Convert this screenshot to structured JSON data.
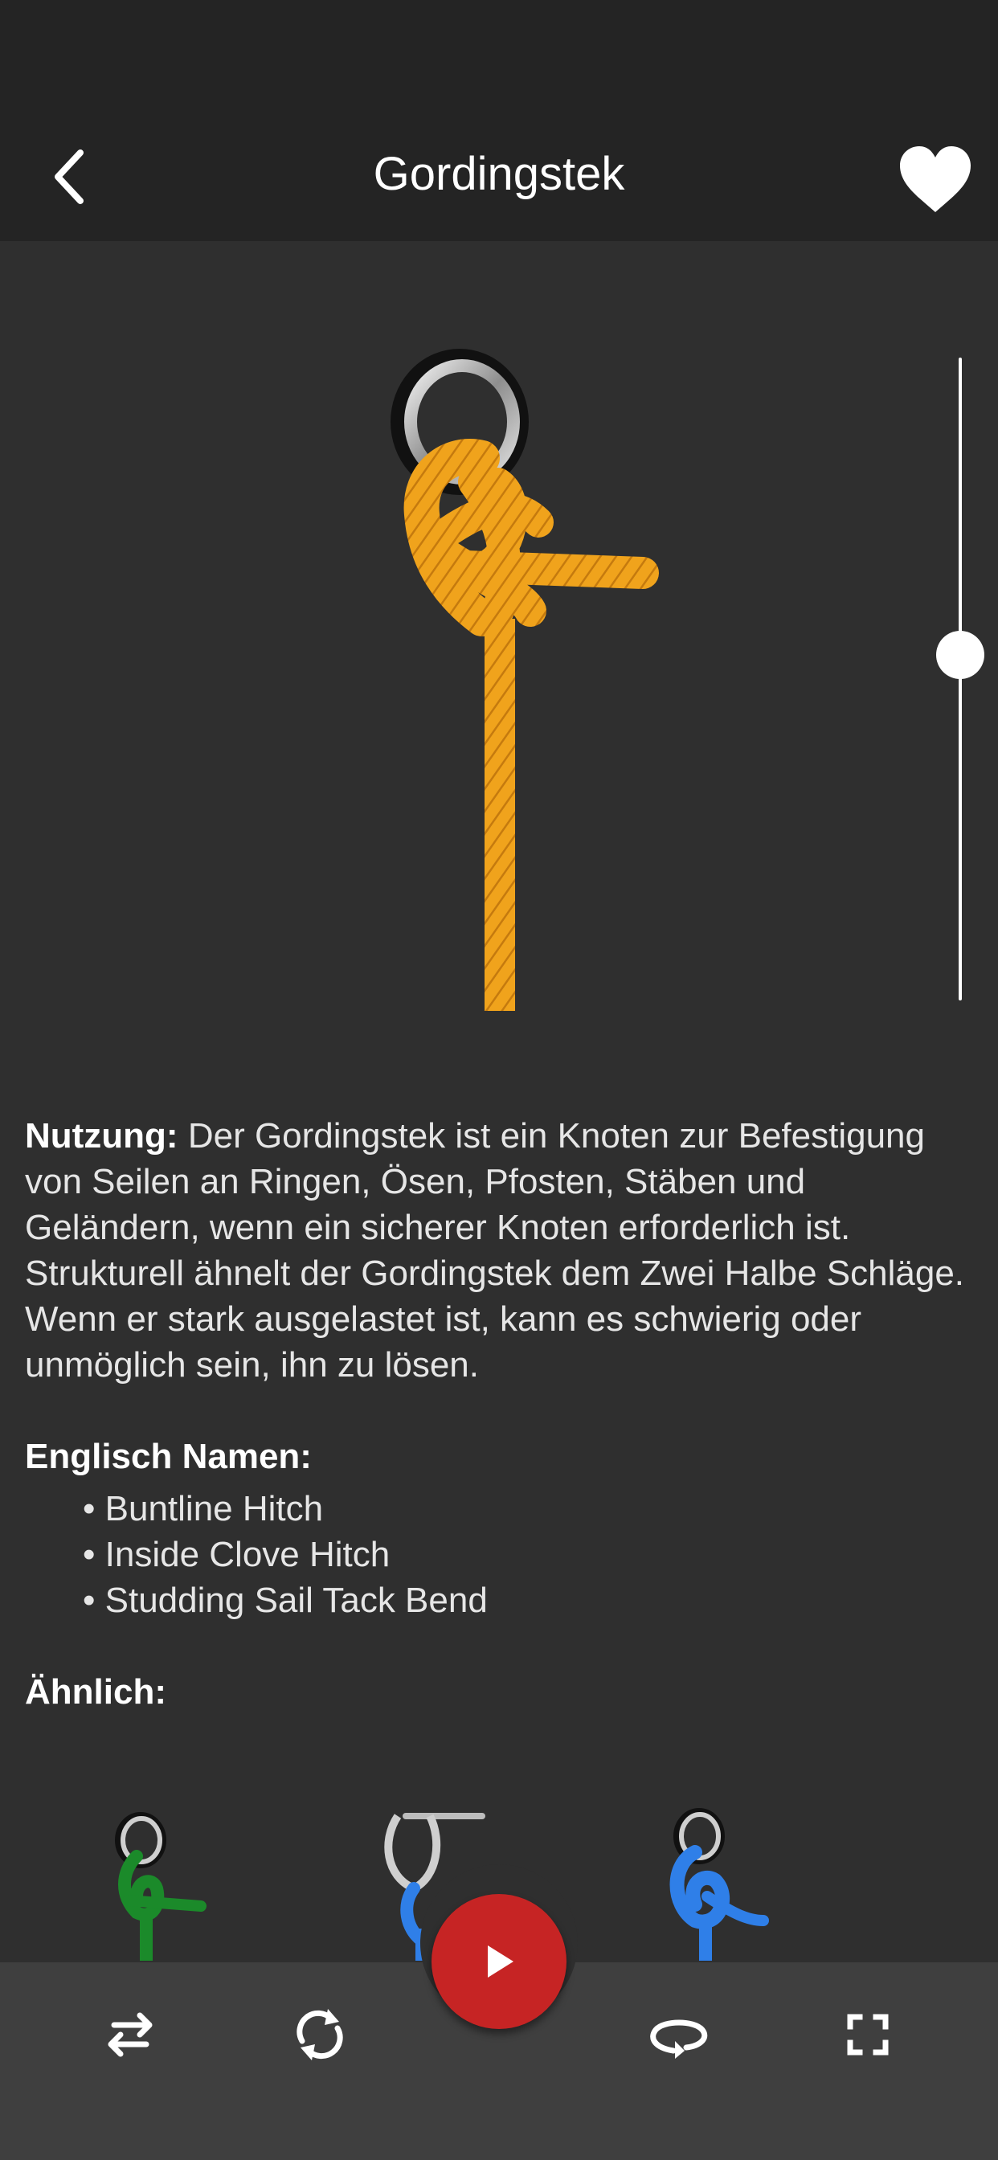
{
  "header": {
    "title": "Gordingstek",
    "back_icon": "chevron-left-icon",
    "favorite_icon": "heart-icon"
  },
  "knot_view": {
    "rope_color": "#f0a31c",
    "ring_color": "#c0c0c0",
    "progress": 0.46
  },
  "usage": {
    "label": "Nutzung:",
    "text": " Der Gordingstek ist ein Knoten zur Befestigung von Seilen an Ringen, Ösen, Pfosten, Stäben und Geländern, wenn ein sicherer Knoten erforderlich ist. Strukturell ähnelt der Gordingstek dem Zwei Halbe Schläge. Wenn er stark ausgelastet ist, kann es schwierig oder unmöglich sein, ihn zu lösen."
  },
  "english_names": {
    "label": "Englisch Namen:",
    "items": [
      "Buntline Hitch",
      "Inside Clove Hitch",
      "Studding Sail Tack Bend"
    ]
  },
  "similar": {
    "label": "Ähnlich:",
    "thumbs": [
      {
        "rope_color": "#1b8a2a"
      },
      {
        "rope_color": "#2f7fe8"
      },
      {
        "rope_color": "#2f7fe8"
      }
    ]
  },
  "toolbar": {
    "buttons": [
      "swap-icon",
      "rotate-icon",
      "play-icon",
      "loop-icon",
      "fullscreen-icon"
    ],
    "play_color": "#c62424"
  }
}
